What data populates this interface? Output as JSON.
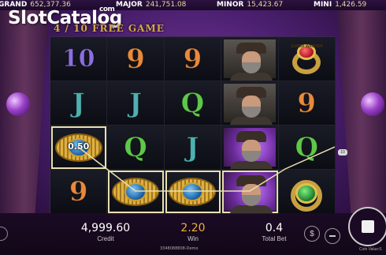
{
  "jackpots": [
    {
      "label": "GRAND",
      "value": "652,377.36"
    },
    {
      "label": "MAJOR",
      "value": "241,751.08"
    },
    {
      "label": "MINOR",
      "value": "15,423.67"
    },
    {
      "label": "MINI",
      "value": "1,426.59"
    }
  ],
  "watermark": {
    "brand": "SlotCatalog",
    "tld": "com"
  },
  "banner": {
    "text": "4 / 10 FREE GAME"
  },
  "reels": [
    [
      "10",
      "9",
      "9",
      "man",
      "ring-red"
    ],
    [
      "J",
      "J",
      "Q",
      "man",
      "9"
    ],
    [
      "coin",
      "Q",
      "J",
      "man-purple",
      "Q"
    ],
    [
      "9",
      "coin",
      "coin",
      "man-purple",
      "ring-green"
    ]
  ],
  "coin_value": "0.50",
  "win_line_number": "10",
  "ring_text": "SUPER WASHER",
  "stats": {
    "credit_value": "4,999.60",
    "credit_label": "Credit",
    "win_value": "2.20",
    "win_label": "Win",
    "bet_value": "0.4",
    "bet_label": "Total Bet"
  },
  "footer": {
    "id": "3348088808-Demo",
    "coin_value_label": "Coin Value:0."
  },
  "colors": {
    "win_value": "#f0b030",
    "jackpot_value": "#e8d6a0"
  }
}
